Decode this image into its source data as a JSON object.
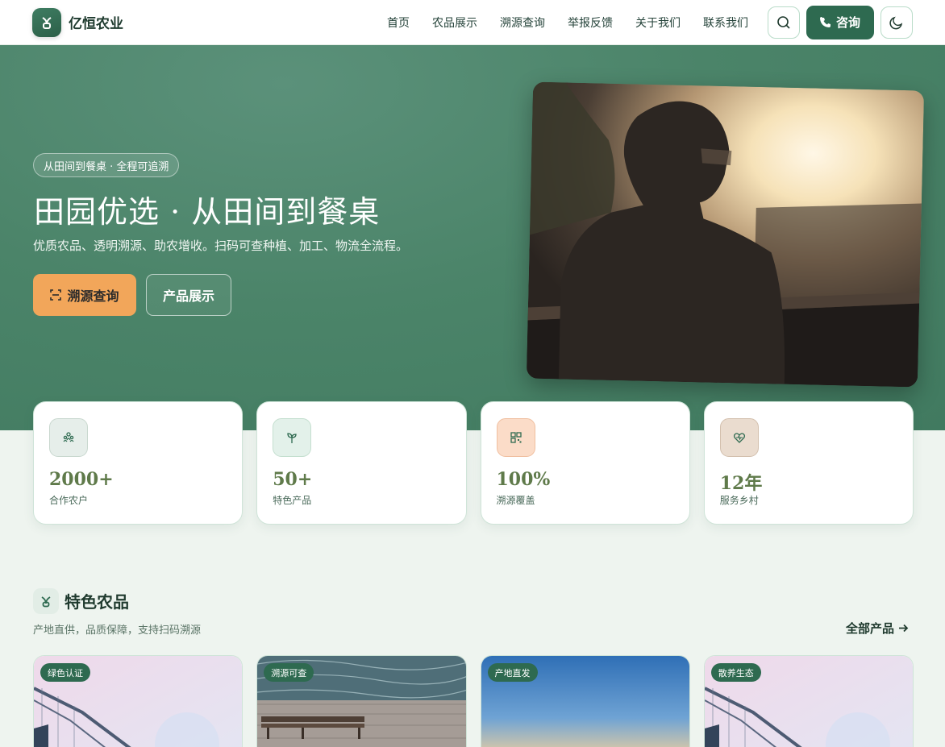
{
  "brand": {
    "name": "亿恒农业"
  },
  "nav": {
    "items": [
      "首页",
      "农品展示",
      "溯源查询",
      "举报反馈",
      "关于我们",
      "联系我们"
    ],
    "consult_label": "咨询"
  },
  "hero": {
    "badge": "从田间到餐桌 · 全程可追溯",
    "title": "田园优选 · 从田间到餐桌",
    "subtitle": "优质农品、透明溯源、助农增收。扫码可查种植、加工、物流全流程。",
    "btn_trace": "溯源查询",
    "btn_products": "产品展示"
  },
  "stats": [
    {
      "value": "2000+",
      "label": "合作农户",
      "icon": "farmers-icon",
      "icon_bg": "#e6eeea"
    },
    {
      "value": "50+",
      "label": "特色产品",
      "icon": "sprout-icon",
      "icon_bg": "#e3f1ea"
    },
    {
      "value": "100%",
      "label": "溯源覆盖",
      "icon": "qrcode-icon",
      "icon_bg": "#fbdcc8"
    },
    {
      "value": "12年",
      "label": "服务乡村",
      "icon": "heart-pulse-icon",
      "icon_bg": "#eadccf"
    }
  ],
  "section": {
    "title": "特色农品",
    "subtitle": "产地直供，品质保障，支持扫码溯源",
    "all_link": "全部产品"
  },
  "products": [
    {
      "tag": "绿色认证",
      "image": "bridge-photo"
    },
    {
      "tag": "溯源可查",
      "image": "pier-photo"
    },
    {
      "tag": "产地直发",
      "image": "sky-photo"
    },
    {
      "tag": "散养生态",
      "image": "bridge-photo"
    }
  ],
  "colors": {
    "primary": "#2e6a50",
    "hero_bg": "#4b8469",
    "accent": "#f2a65a",
    "stat_number": "#5f7a4a"
  }
}
